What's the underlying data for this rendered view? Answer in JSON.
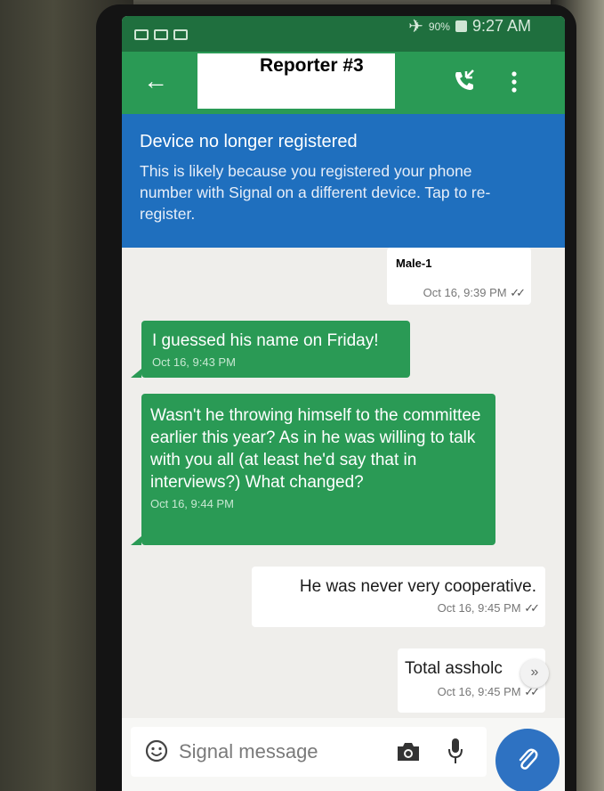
{
  "status_bar": {
    "battery": "90%",
    "time": "9:27 AM"
  },
  "conversation": {
    "title": "Reporter #3"
  },
  "banner": {
    "title": "Device no longer registered",
    "body": "This is likely because you registered your phone number with Signal on a different device. Tap to re-register."
  },
  "messages": [
    {
      "direction": "outgoing",
      "text": "Male-1",
      "time": "Oct 16, 9:39 PM"
    },
    {
      "direction": "incoming",
      "text": "I guessed his name on Friday!",
      "time": "Oct 16, 9:43 PM"
    },
    {
      "direction": "incoming",
      "text": "Wasn't he throwing himself to the committee earlier this year? As in he was willing to talk with you all (at least he'd say that in interviews?) What changed?",
      "time": "Oct 16, 9:44 PM"
    },
    {
      "direction": "outgoing",
      "text": "He was never very cooperative.",
      "time": "Oct 16, 9:45 PM"
    },
    {
      "direction": "outgoing",
      "text": "Total assholc",
      "time": "Oct 16, 9:45 PM"
    }
  ],
  "compose": {
    "placeholder": "Signal message"
  },
  "icons": {
    "back": "back-arrow-icon",
    "call": "phone-call-icon",
    "menu": "overflow-menu-icon",
    "emoji": "smile-icon",
    "camera": "camera-icon",
    "mic": "microphone-icon",
    "attach": "paperclip-icon",
    "scroll_down": "chevron-double-down-icon"
  },
  "colors": {
    "toolbar": "#2a9a55",
    "status_bar": "#1f6f3e",
    "banner": "#1f6fbe",
    "incoming_bubble": "#2a9a55",
    "attach_button": "#2e72c2"
  }
}
